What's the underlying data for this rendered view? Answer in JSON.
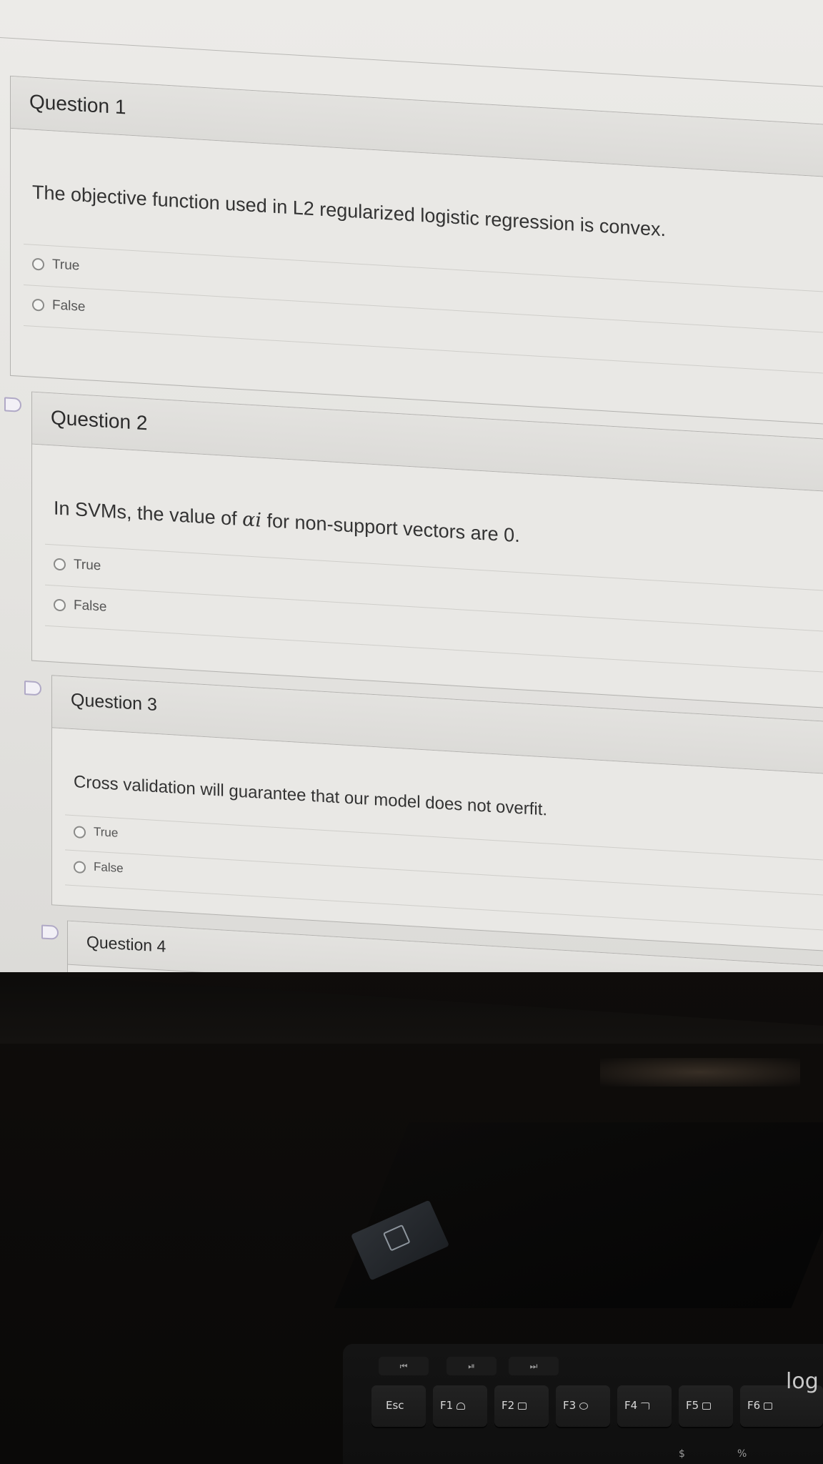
{
  "quiz": {
    "questions": [
      {
        "title": "Question 1",
        "text": "The objective function used in L2 regularized logistic regression is convex.",
        "options": [
          "True",
          "False"
        ]
      },
      {
        "title": "Question 2",
        "text_before": "In SVMs, the value of ",
        "math": "αi",
        "text_after": " for non-support vectors are 0.",
        "options": [
          "True",
          "False"
        ]
      },
      {
        "title": "Question 3",
        "text": "Cross validation will guarantee that our model does not overfit.",
        "options": [
          "True",
          "False"
        ]
      },
      {
        "title": "Question 4"
      }
    ]
  },
  "keyboard": {
    "media_keys": [
      "⏮",
      "⏯",
      "⏭"
    ],
    "keys": [
      "Esc",
      "F1",
      "F2",
      "F3",
      "F4",
      "F5",
      "F6"
    ],
    "brand_partial": "log",
    "number_row_glyphs": [
      "$",
      "%"
    ]
  },
  "colors": {
    "screen_background": "#e6e5e2",
    "border": "#b3b2af",
    "flag_outline": "#b0a9c6",
    "desk": "#120f0d",
    "keyboard": "#141414"
  },
  "icons": {
    "question_flag": "bookmark-flag-icon",
    "answer_option": "radio-button-icon",
    "f1_key": "home-icon",
    "f2_key": "mail-icon",
    "f3_key": "search-icon",
    "f4_key": "music-icon",
    "f5_key": "window-icon",
    "f6_key": "window-icon"
  }
}
